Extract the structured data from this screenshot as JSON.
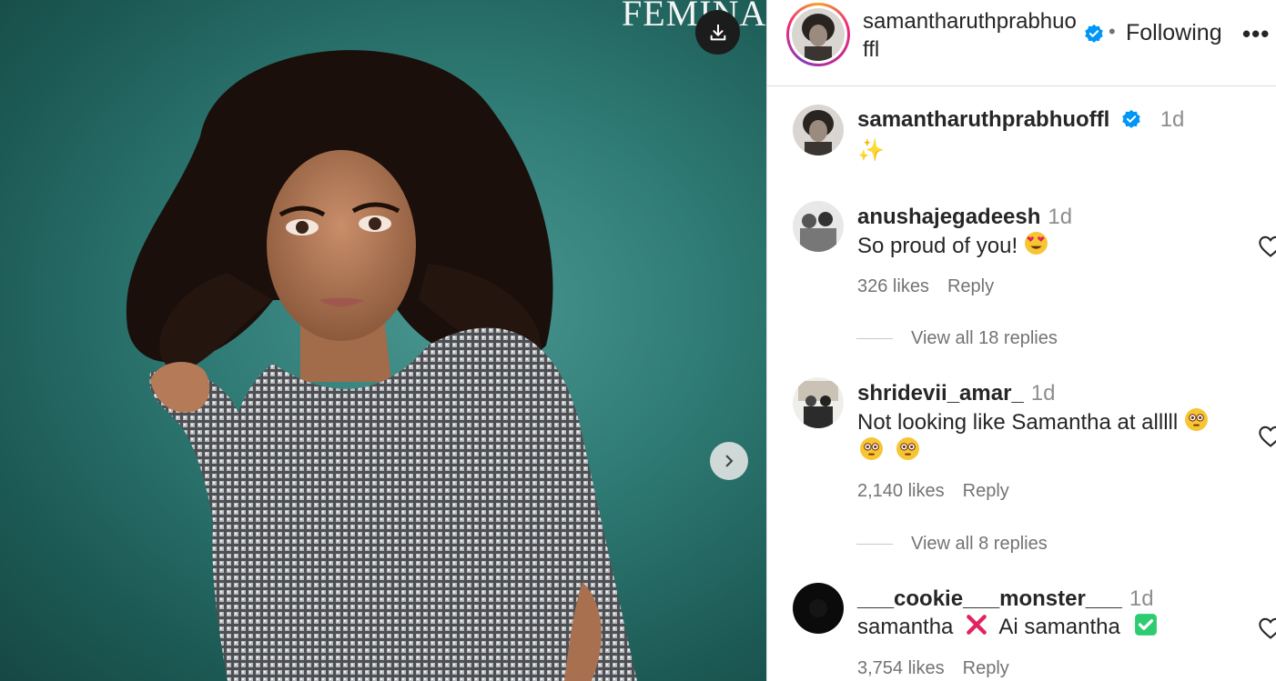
{
  "media": {
    "masthead": "FEMINA",
    "download_icon": "download-icon",
    "next_icon": "chevron-right-icon"
  },
  "header": {
    "username": "samantharuthprabhuoffl",
    "verified_icon": "verified-badge-icon",
    "separator": "•",
    "follow_status": "Following",
    "more_label": "•••"
  },
  "caption": {
    "username": "samantharuthprabhuoffl",
    "time": "1d",
    "text": "✨"
  },
  "comments": [
    {
      "username": "anushajegadeesh",
      "time": "1d",
      "text": "So proud of you!",
      "emoji": "heart-eyes-emoji",
      "likes": "326 likes",
      "reply": "Reply",
      "view_replies": "View all 18 replies"
    },
    {
      "username": "shridevii_amar_",
      "time": "1d",
      "text": "Not looking like Samantha at alllll",
      "emoji": "flushed-face-emoji",
      "likes": "2,140 likes",
      "reply": "Reply",
      "view_replies": "View all 8 replies"
    },
    {
      "username": "___cookie___monster___",
      "time": "1d",
      "text_a": "samantha",
      "text_b": "Ai samantha",
      "likes": "3,754 likes",
      "reply": "Reply"
    }
  ],
  "colors": {
    "verified": "#0095f6",
    "muted": "#737373",
    "divider": "#dbdbdb",
    "background_teal": "#2f7a74"
  }
}
